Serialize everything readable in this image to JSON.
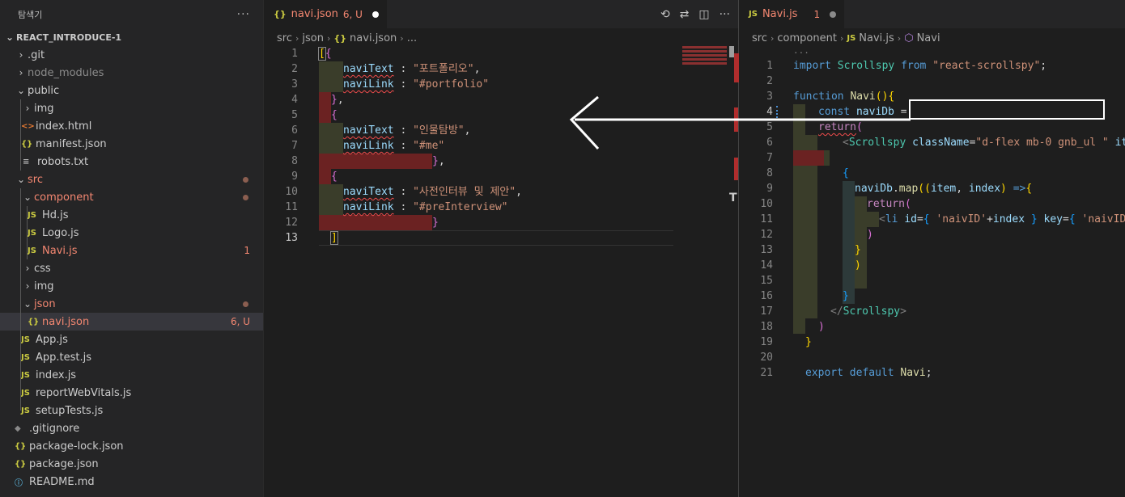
{
  "sidebar": {
    "title": "탐색기",
    "more": "···",
    "project": "REACT_INTRODUCE-1",
    "items": [
      {
        "label": ".git",
        "badge": ""
      },
      {
        "label": "node_modules",
        "badge": ""
      },
      {
        "label": "public",
        "badge": ""
      },
      {
        "label": "img",
        "badge": ""
      },
      {
        "label": "index.html",
        "badge": ""
      },
      {
        "label": "manifest.json",
        "badge": ""
      },
      {
        "label": "robots.txt",
        "badge": ""
      },
      {
        "label": "src",
        "badge": ""
      },
      {
        "label": "component",
        "badge": ""
      },
      {
        "label": "Hd.js",
        "badge": ""
      },
      {
        "label": "Logo.js",
        "badge": ""
      },
      {
        "label": "Navi.js",
        "badge": "1"
      },
      {
        "label": "css",
        "badge": ""
      },
      {
        "label": "img",
        "badge": ""
      },
      {
        "label": "json",
        "badge": ""
      },
      {
        "label": "navi.json",
        "badge": "6, U"
      },
      {
        "label": "App.js",
        "badge": ""
      },
      {
        "label": "App.test.js",
        "badge": ""
      },
      {
        "label": "index.js",
        "badge": ""
      },
      {
        "label": "reportWebVitals.js",
        "badge": ""
      },
      {
        "label": "setupTests.js",
        "badge": ""
      },
      {
        "label": ".gitignore",
        "badge": ""
      },
      {
        "label": "package-lock.json",
        "badge": ""
      },
      {
        "label": "package.json",
        "badge": ""
      },
      {
        "label": "README.md",
        "badge": ""
      }
    ]
  },
  "editor1": {
    "tab_label": "navi.json",
    "tab_badge": "6, U",
    "tab_icon": "{}",
    "crumbs": [
      "src",
      "json",
      "navi.json",
      "..."
    ],
    "line_numbers": [
      "1",
      "2",
      "3",
      "4",
      "5",
      "6",
      "7",
      "8",
      "9",
      "10",
      "11",
      "12",
      "13"
    ],
    "json_keys": {
      "text": "naviText",
      "link": "naviLink"
    },
    "strings": {
      "t1": "\"포트폴리오\"",
      "l1": "\"#portfolio\"",
      "t2": "\"인물탐방\"",
      "l2": "\"#me\"",
      "t3": "\"사전인터뷰 및 제안\"",
      "l3": "\"#preInterview\""
    }
  },
  "editor2": {
    "tab_label": "Navi.js",
    "tab_badge": "1",
    "tab_icon": "JS",
    "crumbs": [
      "src",
      "component",
      "Navi.js",
      "Navi"
    ],
    "line_numbers": [
      "1",
      "2",
      "3",
      "4",
      "5",
      "6",
      "7",
      "8",
      "9",
      "10",
      "11",
      "12",
      "13",
      "14",
      "15",
      "16",
      "17",
      "18",
      "19",
      "20",
      "21"
    ],
    "code": {
      "l0": "...",
      "l1a": "import",
      "l1b": "Scrollspy",
      "l1c": "from",
      "l1d": "\"react-scrollspy\"",
      "l3a": "function",
      "l3b": "Navi",
      "l4a": "const",
      "l4b": "naviDb",
      "l5": "return",
      "l6a": "Scrollspy",
      "l6b": "className",
      "l6c": "\"d-flex mb-0 gnb_ul \"",
      "l6d": "ite",
      "l9a": "naviDb",
      "l9b": "map",
      "l9c": "item",
      "l9d": "index",
      "l10": "return",
      "l11a": "li",
      "l11b": "id",
      "l11c": "'naivID'",
      "l11d": "index",
      "l11e": "key",
      "l11f": "'naivID",
      "l17": "Scrollspy",
      "l21a": "export",
      "l21b": "default",
      "l21c": "Navi"
    }
  }
}
